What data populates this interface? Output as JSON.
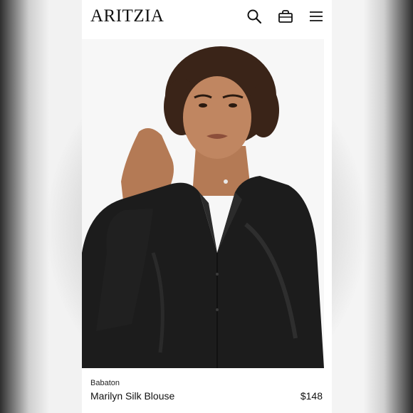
{
  "header": {
    "logo": "ARITZIA",
    "icons": [
      "search-icon",
      "bag-icon",
      "menu-icon"
    ]
  },
  "product": {
    "brand": "Babaton",
    "name": "Marilyn Silk Blouse",
    "price": "$148",
    "image": "model-wearing-black-silk-blouse"
  },
  "colors": {
    "text": "#111111",
    "background": "#ffffff",
    "blouse": "#1c1c1c"
  }
}
